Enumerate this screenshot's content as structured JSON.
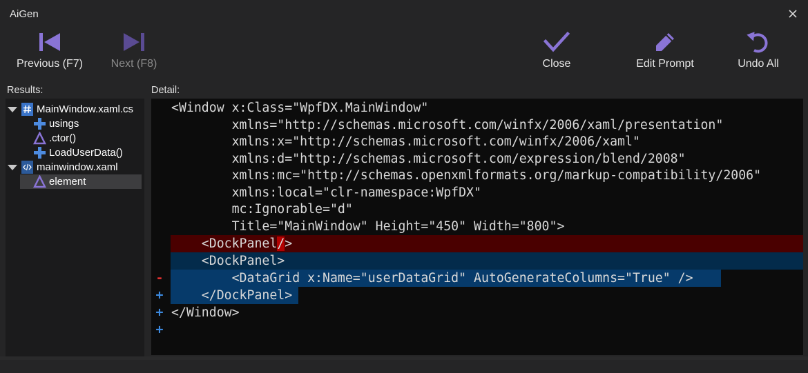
{
  "window": {
    "title": "AiGen"
  },
  "toolbar": {
    "previous_label": "Previous (F7)",
    "next_label": "Next (F8)",
    "close_label": "Close",
    "edit_prompt_label": "Edit Prompt",
    "undo_all_label": "Undo All",
    "accent_color": "#8a74d6"
  },
  "results": {
    "label": "Results:",
    "files": [
      {
        "name": "MainWindow.xaml.cs",
        "icon": "csharp-file-icon",
        "expanded": true,
        "items": [
          {
            "name": "usings",
            "icon": "plus-icon"
          },
          {
            "name": ".ctor()",
            "icon": "triangle-icon"
          },
          {
            "name": "LoadUserData()",
            "icon": "plus-icon"
          }
        ]
      },
      {
        "name": "mainwindow.xaml",
        "icon": "xaml-file-icon",
        "expanded": true,
        "items": [
          {
            "name": "element",
            "icon": "triangle-icon",
            "selected": true
          }
        ]
      }
    ]
  },
  "detail": {
    "label": "Detail:",
    "lines": [
      {
        "marker": "",
        "type": "context",
        "text": "<Window x:Class=\"WpfDX.MainWindow\""
      },
      {
        "marker": "",
        "type": "context",
        "text": "        xmlns=\"http://schemas.microsoft.com/winfx/2006/xaml/presentation\""
      },
      {
        "marker": "",
        "type": "context",
        "text": "        xmlns:x=\"http://schemas.microsoft.com/winfx/2006/xaml\""
      },
      {
        "marker": "",
        "type": "context",
        "text": "        xmlns:d=\"http://schemas.microsoft.com/expression/blend/2008\""
      },
      {
        "marker": "",
        "type": "context",
        "text": "        xmlns:mc=\"http://schemas.openxmlformats.org/markup-compatibility/2006\""
      },
      {
        "marker": "",
        "type": "context",
        "text": "        xmlns:local=\"clr-namespace:WpfDX\""
      },
      {
        "marker": "",
        "type": "context",
        "text": "        mc:Ignorable=\"d\""
      },
      {
        "marker": "",
        "type": "context",
        "text": "        Title=\"MainWindow\" Height=\"450\" Width=\"800\">"
      },
      {
        "marker": "-",
        "type": "removed",
        "text_before_cursor": "    <DockPanel",
        "text_cursor": "/",
        "text_after_cursor": ">"
      },
      {
        "marker": "+",
        "type": "added",
        "text": "    <DockPanel>"
      },
      {
        "marker": "+",
        "type": "added",
        "text": "        <DataGrid x:Name=\"userDataGrid\" AutoGenerateColumns=\"True\" />"
      },
      {
        "marker": "+",
        "type": "added",
        "text": "    </DockPanel>"
      },
      {
        "marker": "",
        "type": "context",
        "text": "</Window>"
      }
    ]
  }
}
